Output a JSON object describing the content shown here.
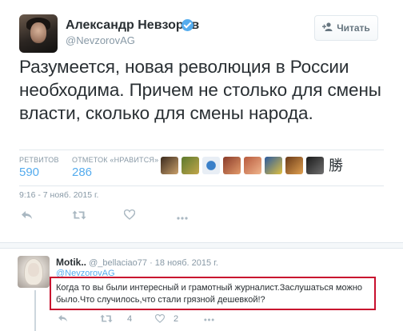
{
  "author": {
    "name": "Александр Невзоров",
    "handle": "@NevzorovAG"
  },
  "follow_button": {
    "label": "Читать"
  },
  "tweet": {
    "text": "Разумеется, новая революция в России необходима. Причем не столько для смены власти, сколько для смены народа.",
    "timestamp": "9:16 - 7 нояб. 2015 г."
  },
  "stats": {
    "retweets_label": "РЕТВИТОВ",
    "retweets_value": "590",
    "likes_label": "ОТМЕТОК «НРАВИТСЯ»",
    "likes_value": "286"
  },
  "favoriters": {
    "last_char": "勝"
  },
  "reply": {
    "name": "Motik..",
    "handle": "@_bellaciao77",
    "date": "· 18 нояб. 2015 г.",
    "mention": "@NevzorovAG",
    "text": "Когда то вы были интересный и грамотный журналист.Заслушаться можно было.Что случилось,что стали грязной дешевкой!?",
    "retweet_count": "4",
    "like_count": "2"
  },
  "colors": {
    "accent": "#55acee",
    "highlight_border": "#c8102e",
    "muted": "#8899a6"
  }
}
